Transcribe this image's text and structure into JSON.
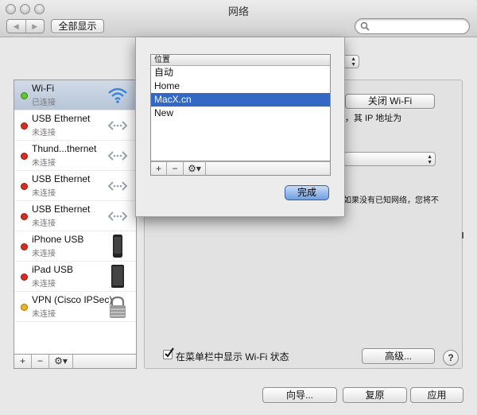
{
  "window": {
    "title": "网络",
    "back_forward": [
      "◀",
      "▶"
    ],
    "show_all_label": "全部显示",
    "search_placeholder": ""
  },
  "colors": {
    "connected": "#5fc82f",
    "disconnected": "#d92c1f",
    "vpn": "#f3b51d",
    "selection": "#3468c5"
  },
  "sidebar": {
    "items": [
      {
        "name": "Wi-Fi",
        "status": "已连接",
        "icon": "wifi-icon",
        "state": "connected"
      },
      {
        "name": "USB Ethernet",
        "status": "未连接",
        "icon": "ethernet-icon",
        "state": "disconnected"
      },
      {
        "name": "Thund...thernet",
        "status": "未连接",
        "icon": "ethernet-icon",
        "state": "disconnected"
      },
      {
        "name": "USB Ethernet",
        "status": "未连接",
        "icon": "ethernet-icon",
        "state": "disconnected"
      },
      {
        "name": "USB Ethernet",
        "status": "未连接",
        "icon": "ethernet-icon",
        "state": "disconnected"
      },
      {
        "name": "iPhone USB",
        "status": "未连接",
        "icon": "iphone-icon",
        "state": "disconnected"
      },
      {
        "name": "iPad USB",
        "status": "未连接",
        "icon": "ipad-icon",
        "state": "disconnected"
      },
      {
        "name": "VPN (Cisco IPSec)",
        "status": "未连接",
        "icon": "vpn-lock-icon",
        "state": "vpn"
      }
    ],
    "tools": [
      "+",
      "−",
      "⚙▾"
    ]
  },
  "detail": {
    "turn_off_wifi_label": "关闭 Wi-Fi",
    "ip_text": "\"，其 IP 地址为",
    "partial_text": "如果没有已知网络，您将不",
    "show_wifi_status_label": "在菜单栏中显示 Wi-Fi 状态",
    "show_wifi_status_checked": true,
    "advanced_label": "高级...",
    "help_label": "?"
  },
  "location_sheet": {
    "header": "位置",
    "locations": [
      "自动",
      "Home",
      "MacX.cn",
      "New"
    ],
    "selected_index": 2,
    "tools": [
      "+",
      "−",
      "⚙▾"
    ],
    "done_label": "完成"
  },
  "footer": {
    "assist_label": "向导...",
    "revert_label": "复原",
    "apply_label": "应用"
  }
}
